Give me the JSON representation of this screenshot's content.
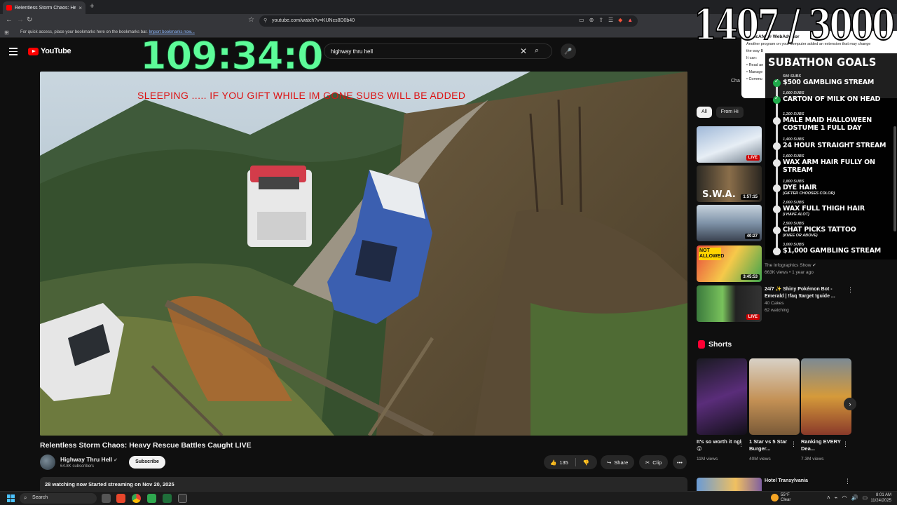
{
  "browser": {
    "tab_title": "Relentless Storm Chaos: Hea...",
    "tab_close": "×",
    "new_tab": "+",
    "url": "youtube.com/watch?v=KUNcs8D0b40",
    "bookmarks_hint": "For quick access, place your bookmarks here on the bookmarks bar.",
    "bookmarks_link": "Import bookmarks now..."
  },
  "youtube": {
    "logo_text": "YouTube",
    "search_value": "highway thru hell"
  },
  "stream_overlay": {
    "timer": "109:34:0",
    "counter": "1407 / 3000",
    "banner": "SLEEPING ..... IF YOU GIFT WHILE IM GONE SUBS WILL BE ADDED",
    "goals_title": "SUBATHON GOALS",
    "goals": [
      {
        "subs": "500 SUBS",
        "name": "$500 GAMBLING STREAM",
        "done": true
      },
      {
        "subs": "1,000 SUBS",
        "name": "CARTON OF MILK ON HEAD",
        "done": true
      },
      {
        "subs": "1,200 SUBS",
        "name": "MALE MAID HALLOWEEN COSTUME 1 FULL DAY",
        "done": false
      },
      {
        "subs": "1,400 SUBS",
        "name": "24 HOUR STRAIGHT STREAM",
        "done": false
      },
      {
        "subs": "1,600 SUBS",
        "name": "WAX ARM HAIR FULLY ON STREAM",
        "done": false
      },
      {
        "subs": "1,800 SUBS",
        "name": "DYE HAIR",
        "note": "(GIFTER CHOOSES COLOR)",
        "done": false
      },
      {
        "subs": "2,000 SUBS",
        "name": "WAX FULL THIGH HAIR",
        "note": "(I HAVE ALOT)",
        "done": false
      },
      {
        "subs": "2,500 SUBS",
        "name": "CHAT PICKS TATTOO",
        "note": "(KNEE OR ABOVE)",
        "done": false
      },
      {
        "subs": "3,000 SUBS",
        "name": "$1,000 GAMBLING STREAM",
        "done": false
      }
    ]
  },
  "popup": {
    "title": "McAfee® WebAdvisor",
    "line1": "Another program on your computer added an extension that may change",
    "line2": "the way B",
    "line3": "It can:",
    "line4": "• Read an",
    "line5": "• Manage",
    "line6": "• Commu"
  },
  "video": {
    "title": "Relentless Storm Chaos: Heavy Rescue Battles Caught LIVE",
    "channel": "Highway Thru Hell",
    "verified": "✔",
    "subscribers": "64.8K subscribers",
    "subscribe_label": "Subscribe",
    "likes": "135",
    "share_label": "Share",
    "clip_label": "Clip",
    "more": "•••",
    "description_head": "28 watching now  Started streaming on Nov 20, 2025"
  },
  "sidebar": {
    "chat_hint": "Cha",
    "chips": [
      "All",
      "From Hi"
    ],
    "recommendations": [
      {
        "badge": "LIVE",
        "live": true,
        "title": "",
        "meta1": "",
        "meta2": ""
      },
      {
        "badge": "1:57:15",
        "live": false,
        "title": "",
        "meta1": "",
        "meta2": ""
      },
      {
        "badge": "40:27",
        "live": false,
        "title": "",
        "meta1": "",
        "meta2": ""
      },
      {
        "badge": "3:45:53",
        "live": false,
        "title": "",
        "meta1": "The Infographics Show ✔",
        "meta2": "663K views • 1 year ago"
      },
      {
        "badge": "LIVE",
        "live": true,
        "title": "24/7 ✨ Shiny Pokémon Bot - Emerald | !faq !target !guide ...",
        "meta1": "40 Cakes",
        "meta2": "62 watching"
      }
    ],
    "thumb_texts": {
      "swa": "S.W.A.",
      "not_allowed": "NOT ALLOWED"
    },
    "shorts_title": "Shorts",
    "shorts": [
      {
        "title": "It's so worth it ngl 😮",
        "views": "11M views"
      },
      {
        "title": "1 Star vs 5 Star Burger...",
        "views": "40M views"
      },
      {
        "title": "Ranking EVERY Dea...",
        "views": "7.3M views"
      }
    ],
    "bottom_rec_title": "Hotel Transylvania"
  },
  "taskbar": {
    "search_placeholder": "Search",
    "weather_temp": "55°F",
    "weather_desc": "Clear",
    "time": "8:01 AM",
    "date": "11/24/2025"
  },
  "colors": {
    "timer": "#5dfc99",
    "banner": "#dd1111",
    "yt_red": "#ff0000",
    "goal_done": "#1faa4a"
  }
}
